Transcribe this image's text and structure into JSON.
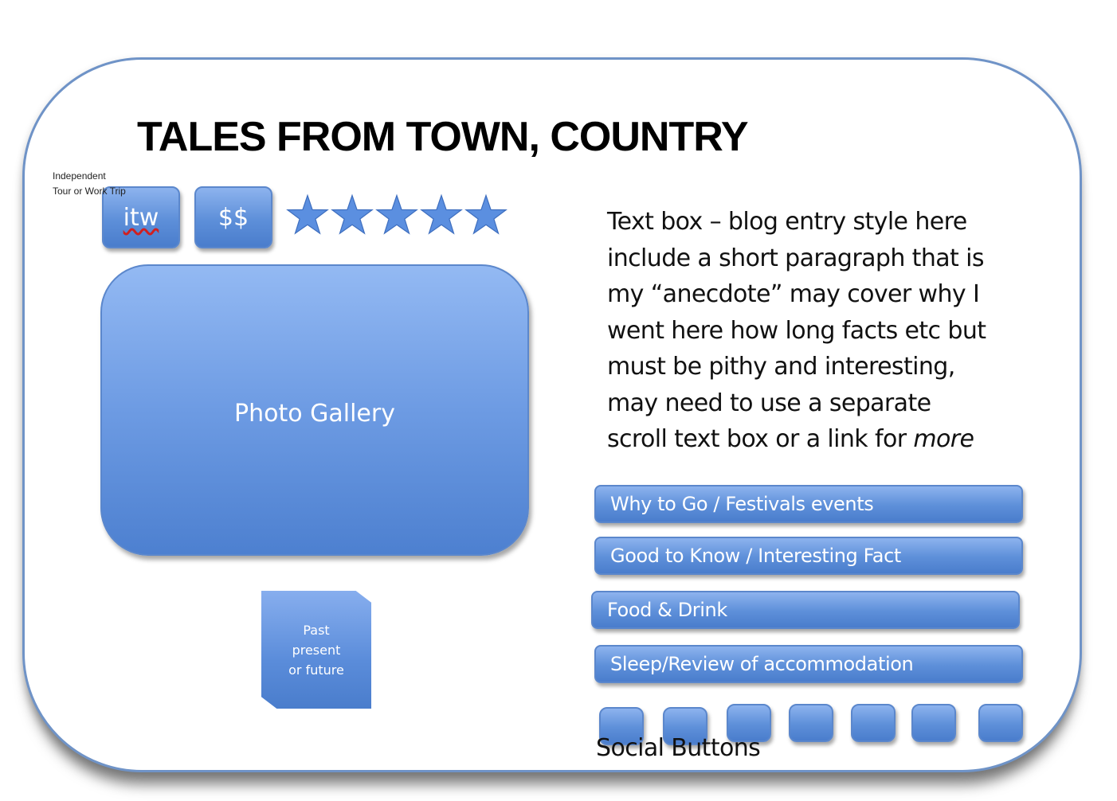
{
  "page": {
    "title": "TALES FROM TOWN, COUNTRY"
  },
  "trip_note": {
    "line1": "Independent",
    "line2": "Tour or Work Trip"
  },
  "badges": {
    "itw": "itw",
    "price": "$$"
  },
  "rating": {
    "stars_filled": 5,
    "stars_total": 5,
    "icon": "star-icon",
    "color": "#5b8fe0"
  },
  "gallery": {
    "label": "Photo Gallery"
  },
  "time_tag": {
    "line1": "Past",
    "line2": "present",
    "line3": "or future"
  },
  "blog": {
    "lines": [
      "Text box – blog entry style here",
      "include a short paragraph that is",
      "my “anecdote” may cover why I",
      "went here how long facts etc but",
      "must be pithy and interesting,",
      "may need to use a separate",
      "scroll text box or a link for "
    ],
    "more": "more"
  },
  "sections": [
    {
      "label": "Why to Go / Festivals events"
    },
    {
      "label": "Good to Know / Interesting Fact"
    },
    {
      "label": "Food & Drink"
    },
    {
      "label": "Sleep/Review of accommodation"
    }
  ],
  "social": {
    "label": "Social Buttons",
    "button_count": 7
  },
  "colors": {
    "button_blue": "#5d8fd9",
    "border_blue": "#6f93c7"
  }
}
